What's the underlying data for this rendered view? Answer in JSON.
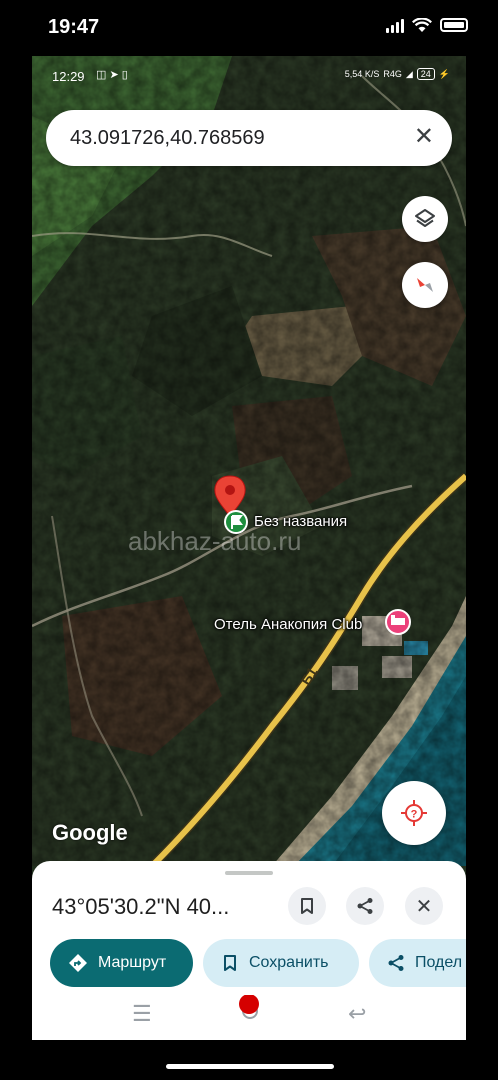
{
  "device": {
    "outer_time": "19:47"
  },
  "inner_status": {
    "time": "12:29",
    "network": "5,54 K/S",
    "signal": "R4G",
    "battery": "24"
  },
  "search": {
    "query": "43.091726,40.768569",
    "clear_icon": "close-icon"
  },
  "map": {
    "pin_label": "Без названия",
    "hotel_label": "Отель Анакопия Club",
    "road_label": "Б1",
    "watermark": "abkhaz-auto.ru",
    "logo": "Google"
  },
  "sheet": {
    "title": "43°05'30.2\"N 40...",
    "route_label": "Маршрут",
    "save_label": "Сохранить",
    "share_label": "Подел"
  },
  "colors": {
    "route_chip": "#0b6b72",
    "secondary_chip": "#d6edf5",
    "pin": "#ea4335",
    "road": "#e8c24a"
  }
}
